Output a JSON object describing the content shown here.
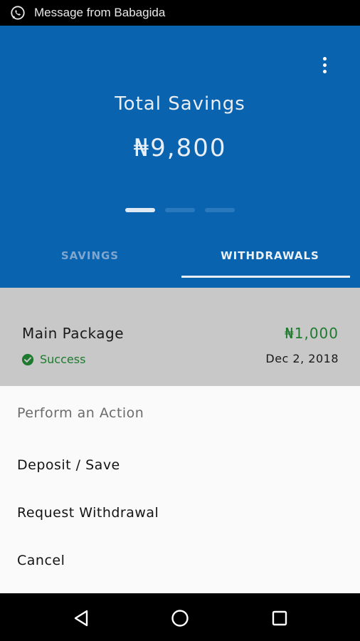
{
  "status_bar": {
    "notification_icon": "whatsapp-icon",
    "notification_text": "Message from Babagida"
  },
  "header": {
    "menu_icon": "more-vert-icon",
    "title": "Total Savings",
    "total_value": "₦9,800",
    "pager": {
      "pages": 3,
      "active_index": 0
    },
    "tabs": [
      {
        "label": "SAVINGS",
        "active": false
      },
      {
        "label": "WITHDRAWALS",
        "active": true
      }
    ],
    "color": "#0a63ae"
  },
  "withdrawal_item": {
    "name": "Main Package",
    "amount": "₦1,000",
    "status": "Success",
    "status_icon": "check-circle-icon",
    "date": "Dec 2, 2018",
    "status_color": "#1e7a2e"
  },
  "action_sheet": {
    "title": "Perform an Action",
    "actions": [
      {
        "label": "Deposit / Save"
      },
      {
        "label": "Request Withdrawal"
      },
      {
        "label": "Cancel"
      }
    ]
  },
  "nav_bar": {
    "back_icon": "back-triangle-icon",
    "home_icon": "home-circle-icon",
    "recents_icon": "recents-square-icon"
  }
}
